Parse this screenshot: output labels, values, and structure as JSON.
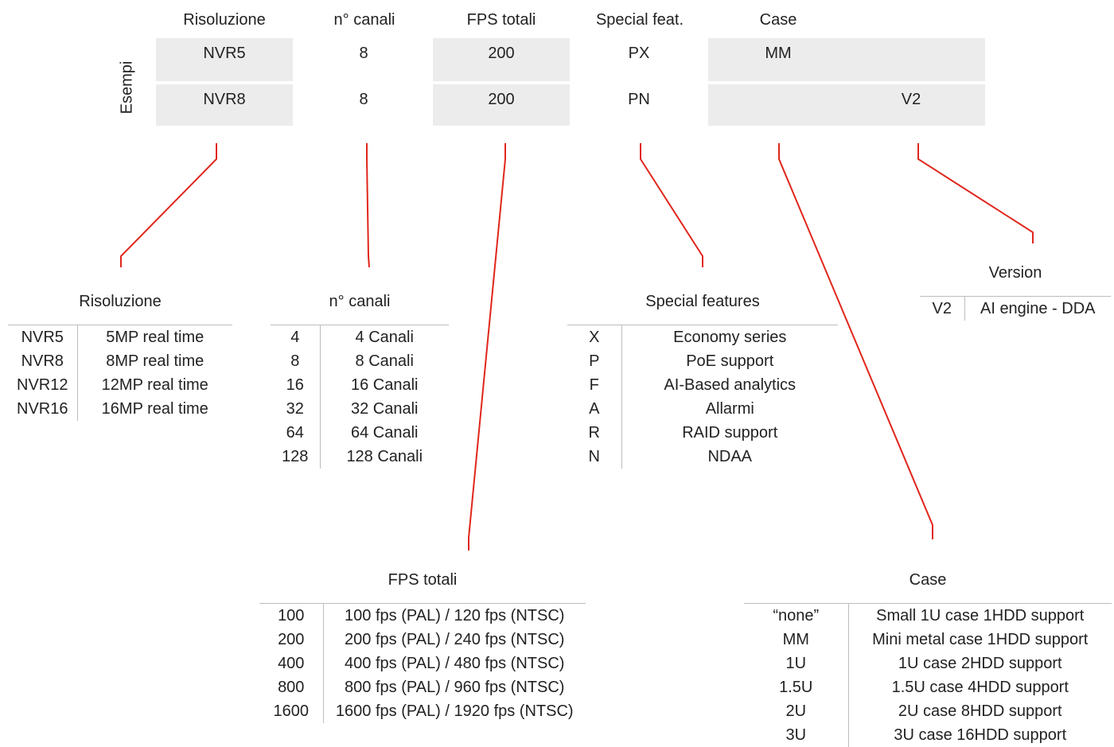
{
  "header": {
    "risoluzione": "Risoluzione",
    "canali": "n° canali",
    "fps": "FPS totali",
    "special": "Special feat.",
    "case": "Case"
  },
  "side_label": "Esempi",
  "examples": [
    {
      "res": "NVR5",
      "ch": "8",
      "fps": "200",
      "special": "PX",
      "case": "MM",
      "version": ""
    },
    {
      "res": "NVR8",
      "ch": "8",
      "fps": "200",
      "special": "PN",
      "case": "",
      "version": "V2"
    }
  ],
  "tables": {
    "risoluzione": {
      "title": "Risoluzione",
      "rows": [
        [
          "NVR5",
          "5MP real time"
        ],
        [
          "NVR8",
          "8MP real time"
        ],
        [
          "NVR12",
          "12MP real time"
        ],
        [
          "NVR16",
          "16MP real time"
        ]
      ]
    },
    "canali": {
      "title": "n° canali",
      "rows": [
        [
          "4",
          "4 Canali"
        ],
        [
          "8",
          "8 Canali"
        ],
        [
          "16",
          "16 Canali"
        ],
        [
          "32",
          "32 Canali"
        ],
        [
          "64",
          "64 Canali"
        ],
        [
          "128",
          "128 Canali"
        ]
      ]
    },
    "special": {
      "title": "Special features",
      "rows": [
        [
          "X",
          "Economy series"
        ],
        [
          "P",
          "PoE support"
        ],
        [
          "F",
          "AI-Based analytics"
        ],
        [
          "A",
          "Allarmi"
        ],
        [
          "R",
          "RAID support"
        ],
        [
          "N",
          "NDAA"
        ]
      ]
    },
    "version": {
      "title": "Version",
      "rows": [
        [
          "V2",
          "AI engine - DDA"
        ]
      ]
    },
    "fps": {
      "title": "FPS totali",
      "rows": [
        [
          "100",
          "100 fps (PAL) / 120 fps (NTSC)"
        ],
        [
          "200",
          "200 fps (PAL) / 240 fps (NTSC)"
        ],
        [
          "400",
          "400 fps (PAL) / 480 fps (NTSC)"
        ],
        [
          "800",
          "800 fps (PAL) / 960 fps (NTSC)"
        ],
        [
          "1600",
          "1600 fps (PAL) / 1920 fps (NTSC)"
        ]
      ]
    },
    "case": {
      "title": "Case",
      "rows": [
        [
          "“none”",
          "Small 1U case 1HDD support"
        ],
        [
          "MM",
          "Mini metal case 1HDD support"
        ],
        [
          "1U",
          "1U case 2HDD support"
        ],
        [
          "1.5U",
          "1.5U case 4HDD support"
        ],
        [
          "2U",
          "2U case 8HDD support"
        ],
        [
          "3U",
          "3U case 16HDD support"
        ]
      ]
    }
  },
  "colors": {
    "line": "#e0261b",
    "cell": "#ececec",
    "border": "#bdbdbd"
  }
}
